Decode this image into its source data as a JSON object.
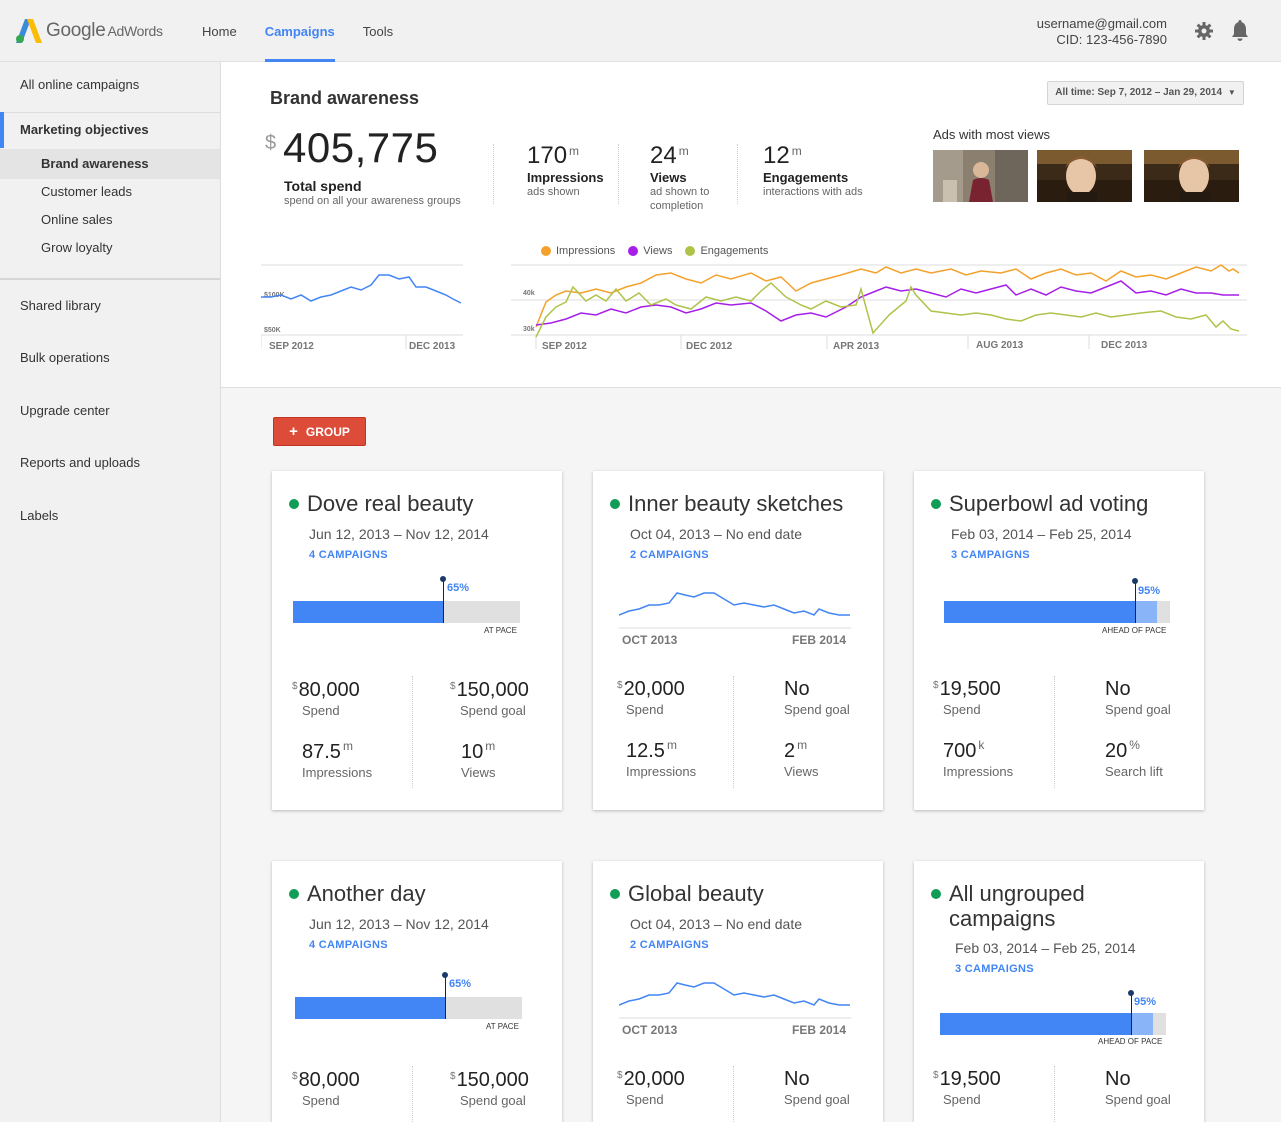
{
  "brand": {
    "name": "Google",
    "product": "AdWords"
  },
  "nav": {
    "home": "Home",
    "campaigns": "Campaigns",
    "tools": "Tools"
  },
  "account": {
    "email": "username@gmail.com",
    "cid": "CID: 123-456-7890"
  },
  "sidebar": {
    "all_online": "All online campaigns",
    "marketing_objectives": "Marketing objectives",
    "brand_awareness": "Brand awareness",
    "customer_leads": "Customer leads",
    "online_sales": "Online sales",
    "grow_loyalty": "Grow loyalty",
    "shared_library": "Shared library",
    "bulk_operations": "Bulk operations",
    "upgrade_center": "Upgrade center",
    "reports_uploads": "Reports and uploads",
    "labels": "Labels"
  },
  "header": {
    "title": "Brand awareness",
    "date_range": "All time: Sep 7, 2012 – Jan 29, 2014",
    "currency": "$",
    "total_spend": "405,775",
    "total_spend_label": "Total spend",
    "total_spend_sub": "spend on all your awareness groups",
    "impressions": {
      "value": "170",
      "unit": "m",
      "label": "Impressions",
      "sub": "ads shown"
    },
    "views": {
      "value": "24",
      "unit": "m",
      "label": "Views",
      "sub": "ad shown to completion"
    },
    "engagements": {
      "value": "12",
      "unit": "m",
      "label": "Engagements",
      "sub": "interactions with ads"
    },
    "ads_title": "Ads with most views"
  },
  "spend_chart": {
    "y_labels": [
      "$100K",
      "$50K"
    ],
    "x_labels": [
      "SEP 2012",
      "DEC 2013"
    ]
  },
  "main_chart": {
    "legend": [
      "Impressions",
      "Views",
      "Engagements"
    ],
    "y_labels": [
      "40k",
      "30k"
    ],
    "x_labels": [
      "SEP 2012",
      "DEC 2012",
      "APR 2013",
      "AUG 2013",
      "DEC 2013"
    ]
  },
  "colors": {
    "impressions": "#f4a12b",
    "views": "#a61ee8",
    "engagements": "#b0c24a",
    "accent": "#4285f4",
    "add": "#dd4b39",
    "status": "#0f9d58"
  },
  "add_group": {
    "plus": "+",
    "label": "GROUP"
  },
  "cards": [
    {
      "title": "Dove real beauty",
      "date": "Jun 12, 2013 – Nov 12, 2014",
      "campaigns": "4 CAMPAIGNS",
      "pace_pct": "65%",
      "pace_label": "AT PACE",
      "s1v": "80,000",
      "s1c": "$",
      "s1l": "Spend",
      "s2v": "150,000",
      "s2c": "$",
      "s2l": "Spend goal",
      "s3v": "87.5",
      "s3u": "m",
      "s3l": "Impressions",
      "s4v": "10",
      "s4u": "m",
      "s4l": "Views"
    },
    {
      "title": "Inner beauty sketches",
      "date": "Oct 04, 2013 – No end date",
      "campaigns": "2 CAMPAIGNS",
      "x1": "OCT 2013",
      "x2": "FEB 2014",
      "s1v": "20,000",
      "s1c": "$",
      "s1l": "Spend",
      "s2v": "No",
      "s2l": "Spend goal",
      "s3v": "12.5",
      "s3u": "m",
      "s3l": "Impressions",
      "s4v": "2",
      "s4u": "m",
      "s4l": "Views"
    },
    {
      "title": "Superbowl ad voting",
      "date": "Feb 03, 2014 – Feb 25, 2014",
      "campaigns": "3 CAMPAIGNS",
      "pace_pct": "95%",
      "pace_label": "AHEAD OF PACE",
      "s1v": "19,500",
      "s1c": "$",
      "s1l": "Spend",
      "s2v": "No",
      "s2l": "Spend goal",
      "s3v": "700",
      "s3u": "k",
      "s3l": "Impressions",
      "s4v": "20",
      "s4u": "%",
      "s4l": "Search lift"
    },
    {
      "title": "Another day",
      "date": "Jun 12, 2013 – Nov 12, 2014",
      "campaigns": "4 CAMPAIGNS",
      "pace_pct": "65%",
      "pace_label": "AT PACE",
      "s1v": "80,000",
      "s1c": "$",
      "s1l": "Spend",
      "s2v": "150,000",
      "s2c": "$",
      "s2l": "Spend goal"
    },
    {
      "title": "Global beauty",
      "date": "Oct 04, 2013 – No end date",
      "campaigns": "2 CAMPAIGNS",
      "x1": "OCT 2013",
      "x2": "FEB 2014",
      "s1v": "20,000",
      "s1c": "$",
      "s1l": "Spend",
      "s2v": "No",
      "s2l": "Spend goal"
    },
    {
      "title": "All ungrouped campaigns",
      "date": "Feb 03, 2014 – Feb 25, 2014",
      "campaigns": "3 CAMPAIGNS",
      "pace_pct": "95%",
      "pace_label": "AHEAD OF PACE",
      "s1v": "19,500",
      "s1c": "$",
      "s1l": "Spend",
      "s2v": "No",
      "s2l": "Spend goal"
    }
  ]
}
